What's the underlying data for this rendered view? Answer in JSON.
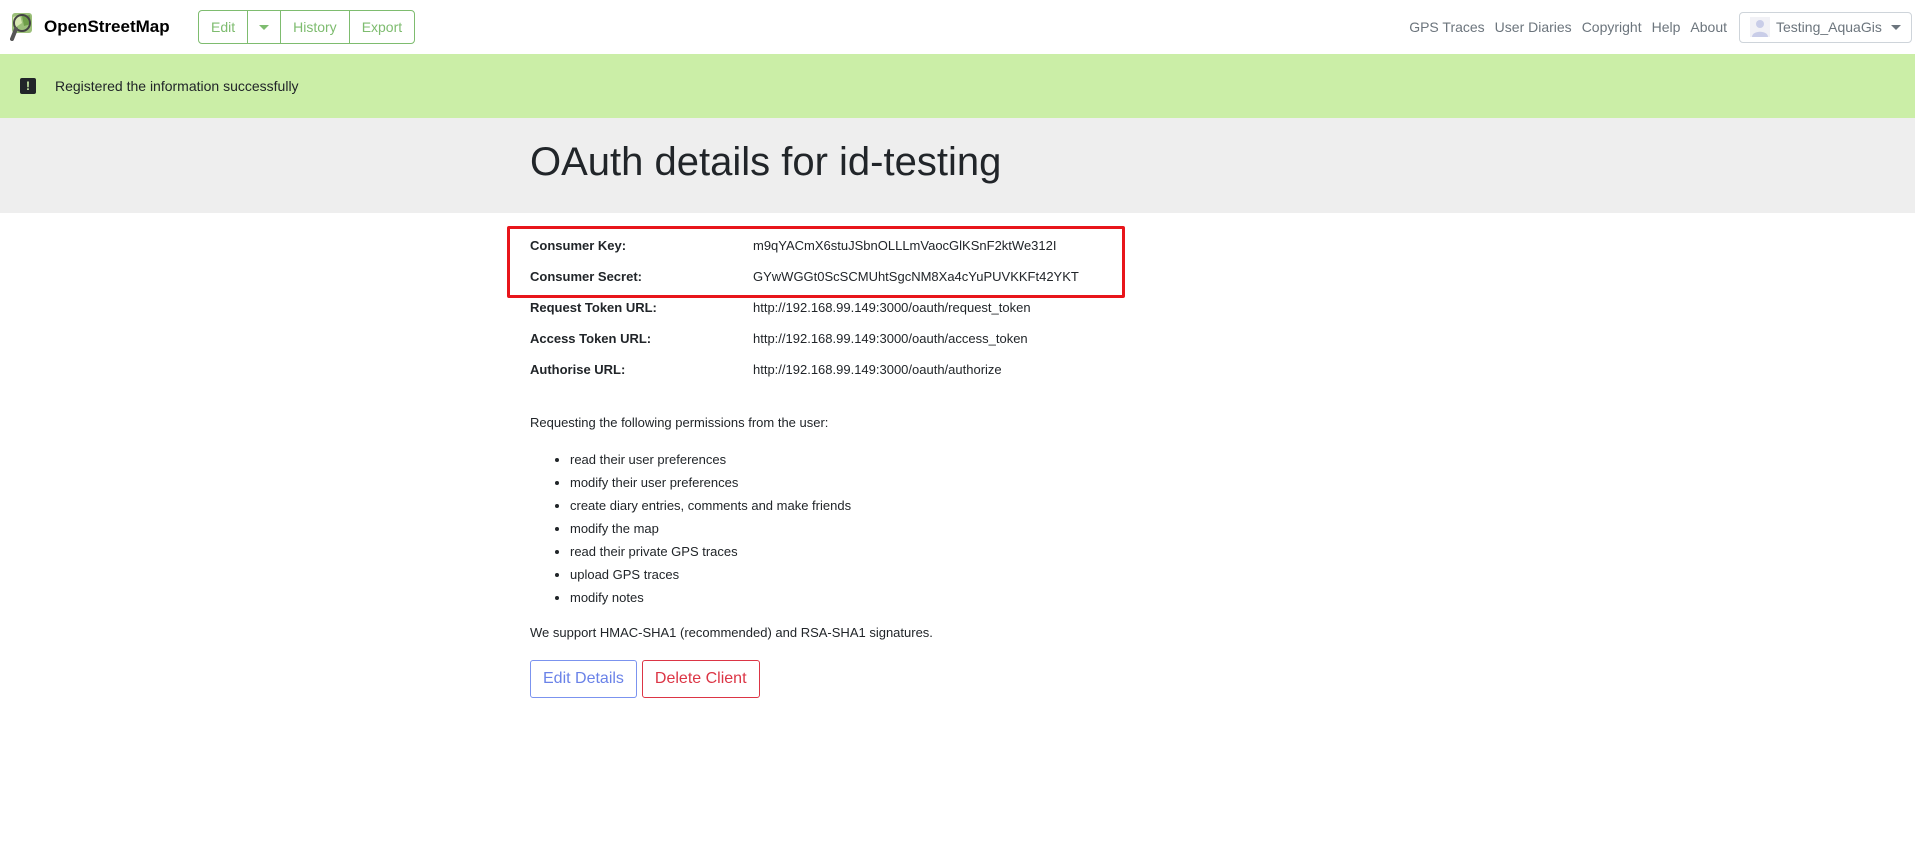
{
  "header": {
    "brand": "OpenStreetMap",
    "edit_tabs": [
      {
        "label": "Edit"
      },
      {
        "label": "History"
      },
      {
        "label": "Export"
      }
    ],
    "nav_links": [
      {
        "label": "GPS Traces"
      },
      {
        "label": "User Diaries"
      },
      {
        "label": "Copyright"
      },
      {
        "label": "Help"
      },
      {
        "label": "About"
      }
    ],
    "user": "Testing_AquaGis",
    "accent_color": "#7ebc6f"
  },
  "flash": {
    "message": "Registered the information successfully",
    "background": "#cbeea7"
  },
  "page": {
    "title": "OAuth details for id-testing"
  },
  "details": [
    {
      "label": "Consumer Key:",
      "value": "m9qYACmX6stuJSbnOLLLmVaocGlKSnF2ktWe312I"
    },
    {
      "label": "Consumer Secret:",
      "value": "GYwWGGt0ScSCMUhtSgcNM8Xa4cYuPUVKKFt42YKT"
    },
    {
      "label": "Request Token URL:",
      "value": "http://192.168.99.149:3000/oauth/request_token"
    },
    {
      "label": "Access Token URL:",
      "value": "http://192.168.99.149:3000/oauth/access_token"
    },
    {
      "label": "Authorise URL:",
      "value": "http://192.168.99.149:3000/oauth/authorize"
    }
  ],
  "permissions": {
    "intro": "Requesting the following permissions from the user:",
    "items": [
      "read their user preferences",
      "modify their user preferences",
      "create diary entries, comments and make friends",
      "modify the map",
      "read their private GPS traces",
      "upload GPS traces",
      "modify notes"
    ]
  },
  "support_text": "We support HMAC-SHA1 (recommended) and RSA-SHA1 signatures.",
  "actions": {
    "edit_label": "Edit Details",
    "delete_label": "Delete Client"
  }
}
